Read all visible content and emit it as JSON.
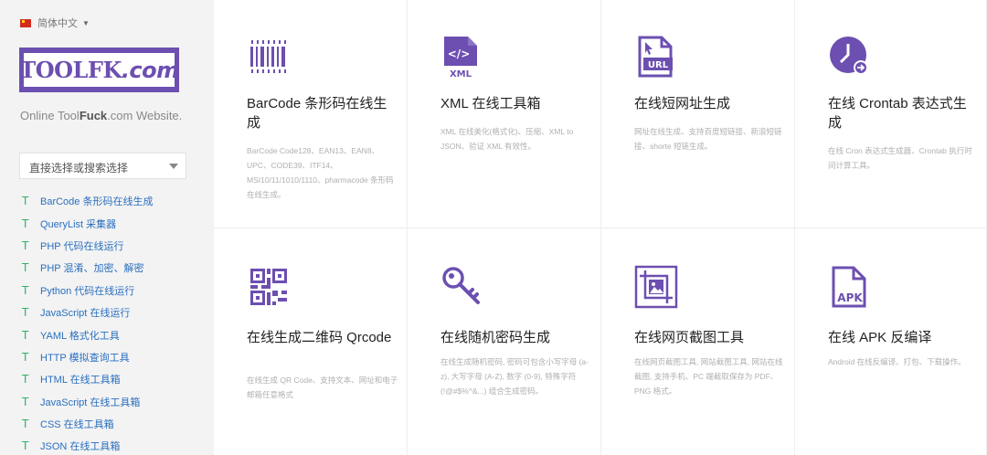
{
  "language": {
    "label": "简体中文"
  },
  "logo": {
    "main": "TOOLFK",
    "suffix": ".com"
  },
  "tagline": {
    "prefix": "Online Tool",
    "bold": "Fuck",
    "suffix": ".com Website."
  },
  "search": {
    "placeholder": "直接选择或搜索选择"
  },
  "nav": {
    "marker": "T",
    "items": [
      "BarCode 条形码在线生成",
      "QueryList 采集器",
      "PHP 代码在线运行",
      "PHP 混淆、加密、解密",
      "Python 代码在线运行",
      "JavaScript 在线运行",
      "YAML 格式化工具",
      "HTTP 模拟查询工具",
      "HTML 在线工具箱",
      "JavaScript 在线工具箱",
      "CSS 在线工具箱",
      "JSON 在线工具箱"
    ]
  },
  "cards": [
    {
      "icon": "barcode-icon",
      "title": "BarCode 条形码在线生成",
      "desc": "BarCode Code128、EAN13、EAN8、UPC、CODE39、ITF14、MSI10/11/1010/1110、pharmacode 条形码在线生成。"
    },
    {
      "icon": "xml-file-icon",
      "title": "XML 在线工具箱",
      "desc": "XML 在线美化(格式化)、压缩、XML to JSON、验证 XML 有效性。"
    },
    {
      "icon": "url-file-icon",
      "title": "在线短网址生成",
      "desc": "网址在线生成、支持百度短链接、新浪短链接、shorte 短链生成。"
    },
    {
      "icon": "clock-icon",
      "title": "在线 Crontab 表达式生成",
      "desc": "在线 Cron 表达式生成器、Crontab 执行时间计算工具。"
    },
    {
      "icon": "qrcode-icon",
      "title": "在线生成二维码 Qrcode",
      "desc": "在线生成 QR Code、支持文本、网址和电子邮箱任意格式"
    },
    {
      "icon": "key-icon",
      "title": "在线随机密码生成",
      "desc": "在线生成随机密码, 密码可包含小写字母 (a-z), 大写字母 (A-Z), 数字 (0-9), 特殊字符 (!@#$%^&...) 组合生成密码。"
    },
    {
      "icon": "screenshot-icon",
      "title": "在线网页截图工具",
      "desc": "在线网页截图工具, 网站截图工具, 网站在线截图, 支持手机、PC 端截取保存为 PDF、PNG 格式。"
    },
    {
      "icon": "apk-file-icon",
      "title": "在线 APK 反编译",
      "desc": "Android 在线反编译、打包、下载操作。"
    }
  ],
  "colors": {
    "accent": "#6c4fb0",
    "link": "#2a6fbf",
    "marker": "#33b06a"
  }
}
